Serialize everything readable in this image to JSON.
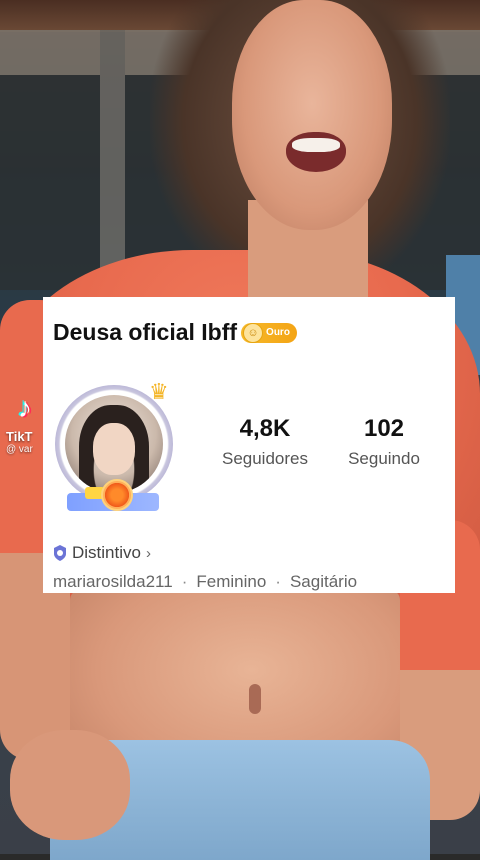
{
  "watermark": {
    "app_name": "TikT",
    "handle": "@ var"
  },
  "profile": {
    "name": "Deusa oficial Ibff",
    "rank_badge": "Ouro",
    "followers_value": "4,8K",
    "followers_label": "Seguidores",
    "following_value": "102",
    "following_label": "Seguindo",
    "badge_link_label": "Distintivo",
    "username": "mariarosilda211",
    "gender": "Feminino",
    "zodiac": "Sagitário"
  },
  "colors": {
    "card_bg": "#ffffff",
    "rank_badge": "#f4a415",
    "shirt": "#e86a4e",
    "shield_icon": "#6b74d6"
  },
  "icons": {
    "rank": "coin-icon",
    "badge": "shield-icon",
    "chevron": "chevron-right-icon",
    "crown": "crown-icon"
  }
}
